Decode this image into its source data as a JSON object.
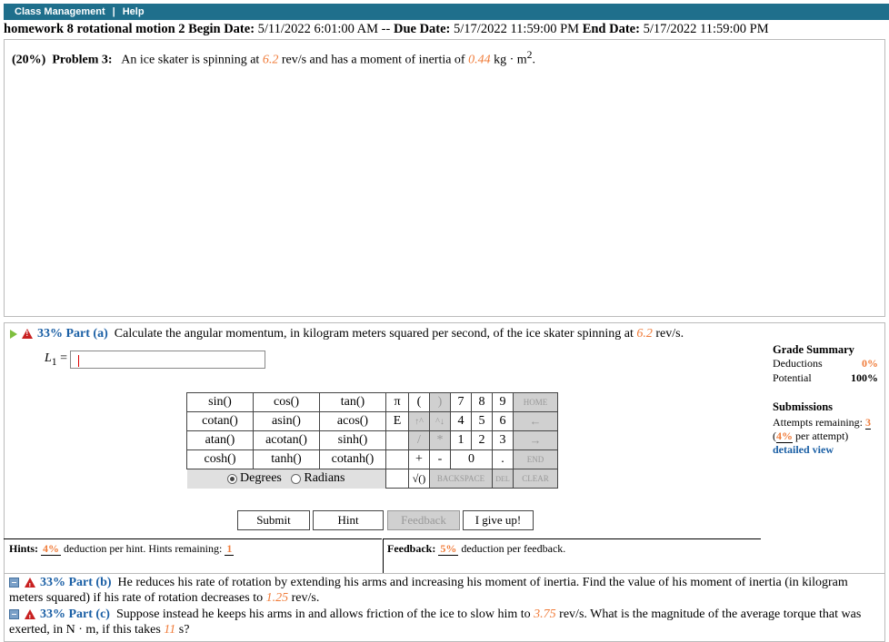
{
  "menu": {
    "class_management": "Class Management",
    "separator": "|",
    "help": "Help"
  },
  "assignment": {
    "name": "homework 8 rotational motion 2",
    "begin_label": "Begin Date:",
    "begin_value": "5/11/2022 6:01:00 AM",
    "separator": "--",
    "due_label": "Due Date:",
    "due_value": "5/17/2022 11:59:00 PM",
    "end_label": "End Date:",
    "end_value": "5/17/2022 11:59:00 PM"
  },
  "problem": {
    "weight": "(20%)",
    "title": "Problem 3:",
    "text_1": "An ice skater is spinning at",
    "rate": "6.2",
    "text_2": "rev/s and has a moment of inertia of",
    "inertia": "0.44",
    "text_3": "kg · m",
    "sup": "2",
    "text_4": "."
  },
  "part_a": {
    "percent": "33% Part (a)",
    "text_1": "Calculate the angular momentum, in kilogram meters squared per second, of the ice skater spinning at",
    "rate": "6.2",
    "text_2": "rev/s.",
    "answer_label": "L",
    "answer_sub": "1",
    "answer_eq": " =",
    "answer_value": ""
  },
  "grade_summary": {
    "title": "Grade Summary",
    "deductions_label": "Deductions",
    "deductions_value": "0%",
    "potential_label": "Potential",
    "potential_value": "100%"
  },
  "submissions": {
    "title": "Submissions",
    "attempts_label": "Attempts remaining:",
    "attempts_value": "3",
    "per_attempt_open": "(",
    "per_attempt_value": "4%",
    "per_attempt_text": " per attempt)",
    "detailed_view": "detailed view"
  },
  "calculator": {
    "functions": [
      [
        "sin()",
        "cos()",
        "tan()"
      ],
      [
        "cotan()",
        "asin()",
        "acos()"
      ],
      [
        "atan()",
        "acotan()",
        "sinh()"
      ],
      [
        "cosh()",
        "tanh()",
        "cotanh()"
      ]
    ],
    "keys": {
      "pi": "π",
      "lparen": "(",
      "rparen": ")",
      "seven": "7",
      "eight": "8",
      "nine": "9",
      "home": "HOME",
      "e": "E",
      "up": "↑^",
      "down": "^↓",
      "four": "4",
      "five": "5",
      "six": "6",
      "left": "←",
      "div": "/",
      "mul": "*",
      "one": "1",
      "two": "2",
      "three": "3",
      "right": "→",
      "plus": "+",
      "minus": "-",
      "zero": "0",
      "dot": ".",
      "end": "END",
      "sqrt": "√()",
      "backspace": "BACKSPACE",
      "del": "DEL",
      "clear": "CLEAR"
    },
    "degrees": "Degrees",
    "radians": "Radians",
    "mode": "degrees"
  },
  "buttons": {
    "submit": "Submit",
    "hint": "Hint",
    "feedback": "Feedback",
    "give_up": "I give up!"
  },
  "hints": {
    "label": "Hints:",
    "pct": "4%",
    "text": "deduction per hint. Hints remaining:",
    "remaining": "1"
  },
  "feedback": {
    "label": "Feedback:",
    "pct": "5%",
    "text": "deduction per feedback."
  },
  "part_b": {
    "percent": "33% Part (b)",
    "text_1": "He reduces his rate of rotation by extending his arms and increasing his moment of inertia. Find the value of his moment of inertia (in kilogram meters squared) if his rate of rotation decreases to",
    "rate": "1.25",
    "text_2": "rev/s."
  },
  "part_c": {
    "percent": "33% Part (c)",
    "text_1": "Suppose instead he keeps his arms in and allows friction of the ice to slow him to",
    "rate": "3.75",
    "text_2": "rev/s. What is the magnitude of the average torque that was exerted, in N · m, if this takes",
    "time": "11",
    "text_3": "s?"
  }
}
